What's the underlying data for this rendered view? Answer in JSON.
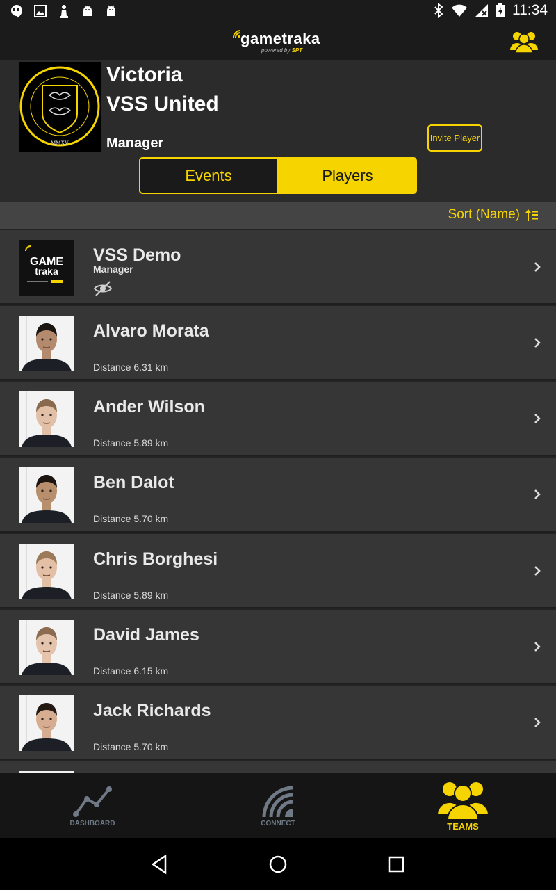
{
  "status": {
    "time": "11:34"
  },
  "app": {
    "brand": "gametraka",
    "brand_sub_prefix": "powered by ",
    "brand_sub_accent": "SPT"
  },
  "team": {
    "first_line": "Victoria",
    "name": "VSS United",
    "role": "Manager",
    "crest_motto": "MMXV"
  },
  "actions": {
    "invite": "Invite Player"
  },
  "tabs": [
    {
      "label": "Events",
      "active": false
    },
    {
      "label": "Players",
      "active": true
    }
  ],
  "sort": {
    "label": "Sort (Name)"
  },
  "players": [
    {
      "name": "VSS Demo",
      "role": "Manager",
      "hidden": true,
      "logo": true
    },
    {
      "name": "Alvaro Morata",
      "distance": "Distance 6.31 km",
      "skin": "#b48a6e",
      "hair": "#1b1511"
    },
    {
      "name": "Ander Wilson",
      "distance": "Distance 5.89 km",
      "skin": "#e2c0a8",
      "hair": "#8a6a4e"
    },
    {
      "name": "Ben Dalot",
      "distance": "Distance 5.70 km",
      "skin": "#b88f6c",
      "hair": "#1b1410"
    },
    {
      "name": "Chris Borghesi",
      "distance": "Distance 5.89 km",
      "skin": "#e3bfa6",
      "hair": "#9a7a58"
    },
    {
      "name": "David James",
      "distance": "Distance 6.15 km",
      "skin": "#e5c4ad",
      "hair": "#8c6c50"
    },
    {
      "name": "Jack Richards",
      "distance": "Distance 5.70 km",
      "skin": "#d6ad90",
      "hair": "#241a14"
    }
  ],
  "logo_tile": {
    "line1": "GAME",
    "line2": "traka"
  },
  "nav": [
    {
      "label": "DASHBOARD",
      "icon": "dashboard-chart-icon",
      "active": false
    },
    {
      "label": "CONNECT",
      "icon": "connect-signal-icon",
      "active": false
    },
    {
      "label": "TEAMS",
      "icon": "teams-people-icon",
      "active": true
    }
  ],
  "colors": {
    "accent": "#f5d400",
    "background": "#2f2f2f",
    "row": "#363636",
    "nav_inactive": "#6f7a86"
  }
}
